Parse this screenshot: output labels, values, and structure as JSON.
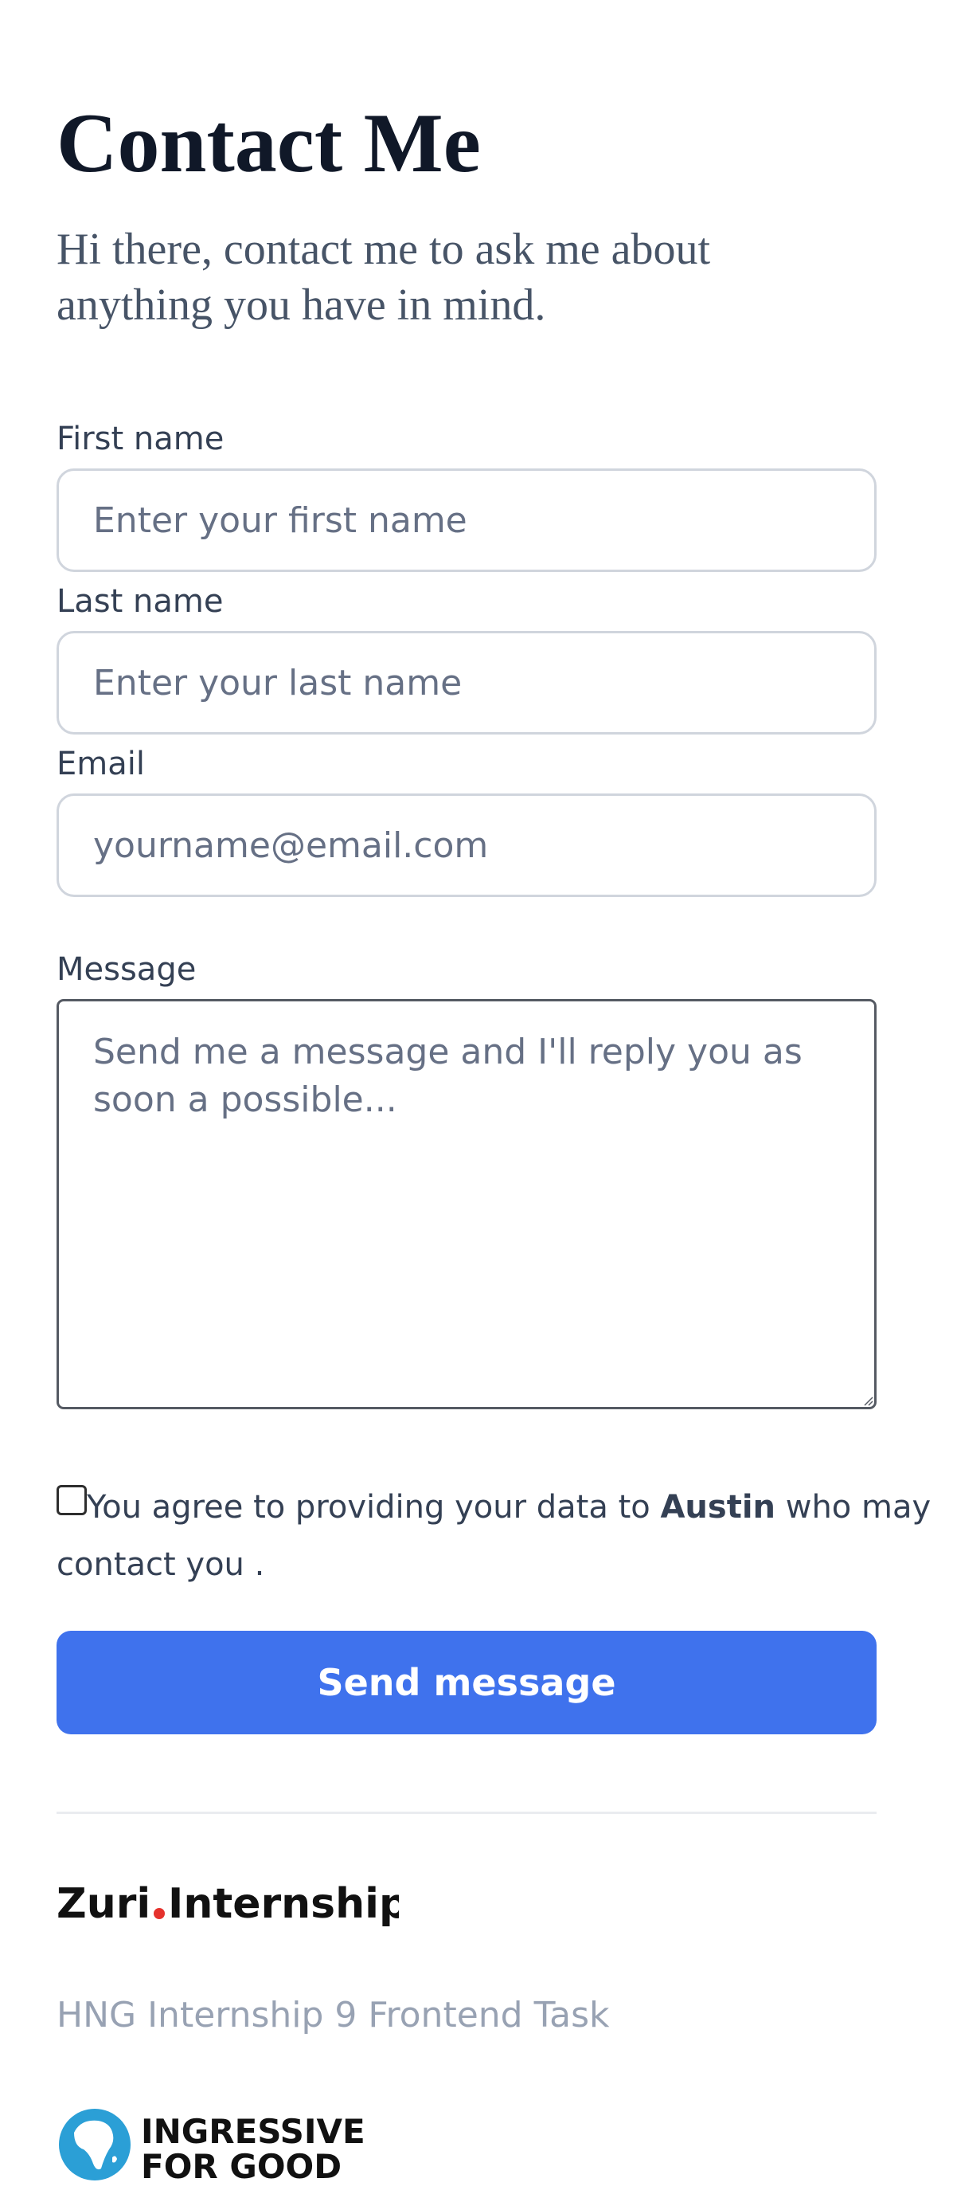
{
  "header": {
    "title": "Contact Me",
    "subtitle": "Hi there, contact me to ask me about anything you have in mind."
  },
  "form": {
    "first_name": {
      "label": "First name",
      "placeholder": "Enter your first name",
      "value": ""
    },
    "last_name": {
      "label": "Last name",
      "placeholder": "Enter your last name",
      "value": ""
    },
    "email": {
      "label": "Email",
      "placeholder": "yourname@email.com",
      "value": ""
    },
    "message": {
      "label": "Message",
      "placeholder": "Send me a message and I'll reply you as soon a possible...",
      "value": ""
    },
    "consent": {
      "checked": false,
      "text_before": "You agree to providing your data to ",
      "name": "Austin",
      "text_after": " who may contact you ."
    },
    "submit_label": "Send message"
  },
  "footer": {
    "zuri_logo": {
      "text": "Zuri.Internship",
      "dot_color": "#e5322d"
    },
    "task_text": "HNG Internship 9 Frontend Task",
    "ingressive_logo": {
      "line1": "INGRESSIVE",
      "line2": "FOR GOOD",
      "globe_color": "#2b9fd6"
    }
  },
  "colors": {
    "accent": "#3f72ed",
    "heading": "#101828",
    "subtitle": "#475467",
    "muted": "#98a2b3"
  },
  "icons": [
    "resize-grip-icon",
    "africa-globe-icon"
  ]
}
